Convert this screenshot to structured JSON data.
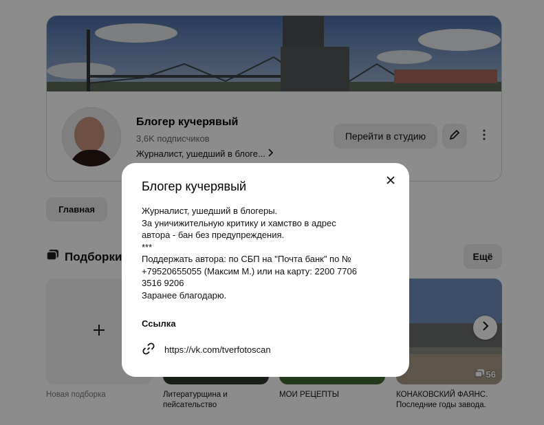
{
  "channel": {
    "title": "Блогер кучерявый",
    "subscribers": "3,6K подписчиков",
    "short_description": "Журналист, ушедший в блоге...",
    "studio_button": "Перейти в студию",
    "edit_icon": "pencil-icon",
    "more_icon": "vertical-dots-icon"
  },
  "tabs": [
    {
      "label": "Главная"
    }
  ],
  "collections": {
    "title": "Подборки",
    "more_label": "Ещё",
    "items": [
      {
        "caption": "Новая подборка"
      },
      {
        "caption_line1": "Литературщина и",
        "caption_line2": "пейсательство"
      },
      {
        "caption_line1": "МОИ РЕЦЕПТЫ"
      },
      {
        "caption_line1": "КОНАКОВСКИЙ ФАЯНС.",
        "caption_line2": "Последние годы завода.",
        "count": "56"
      }
    ]
  },
  "modal": {
    "title": "Блогер кучерявый",
    "description": [
      "Журналист, ушедший в блогеры.",
      "За уничижительную критику и хамство в адрес",
      "автора - бан без предупреждения.",
      "***",
      "Поддержать автора: по СБП на \"Почта банк\" по №",
      "+79520655055 (Максим М.) или на карту: 2200 7706",
      "3516 9206",
      "Заранее благодарю."
    ],
    "link_heading": "Ссылка",
    "link_url": "https://vk.com/tverfotoscan",
    "link_icon": "link-icon",
    "close_icon": "close-icon"
  }
}
